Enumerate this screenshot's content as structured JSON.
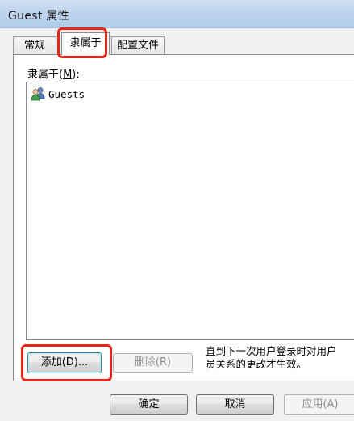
{
  "window": {
    "title": "Guest 属性"
  },
  "tabs": [
    {
      "label": "常规",
      "active": false
    },
    {
      "label": "隶属于",
      "active": true
    },
    {
      "label": "配置文件",
      "active": false
    }
  ],
  "memberof": {
    "label_prefix": "隶属于(",
    "label_key": "M",
    "label_suffix": "):",
    "items": [
      {
        "name": "Guests",
        "icon": "group-icon"
      }
    ]
  },
  "actions": {
    "add_label": "添加(D)...",
    "remove_label": "删除(R)",
    "remove_enabled": false
  },
  "note": {
    "line1": "直到下一次用户登录时对用户",
    "line2": "员关系的更改才生效。"
  },
  "footer": {
    "ok_label": "确定",
    "cancel_label": "取消",
    "apply_label": "应用(A)",
    "apply_enabled": false
  },
  "colors": {
    "highlight": "#e8231a",
    "titlebar": "#bcd3ee",
    "dialog_bg": "#f0f0f0"
  }
}
